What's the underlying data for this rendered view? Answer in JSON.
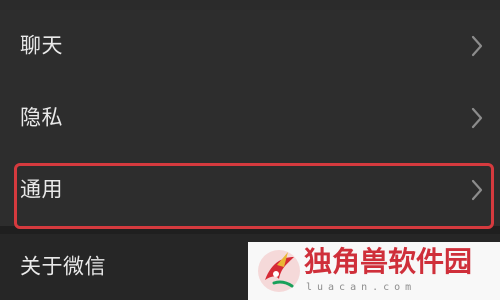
{
  "settings": {
    "items": [
      {
        "label": "聊天",
        "icon": "chevron-right-icon"
      },
      {
        "label": "隐私",
        "icon": "chevron-right-icon"
      },
      {
        "label": "通用",
        "icon": "chevron-right-icon",
        "highlighted": true
      },
      {
        "label": "关于微信"
      }
    ]
  },
  "highlight": {
    "color": "#d53a3e"
  },
  "watermark": {
    "title": "独角兽软件园",
    "subtitle": "luacan.com",
    "logo": "unicorn-logo"
  },
  "colors": {
    "background": "#2b2b2b",
    "text": "#e9e9e9",
    "chevron": "#8c8c8c",
    "watermark_text": "#cf2f3a"
  }
}
